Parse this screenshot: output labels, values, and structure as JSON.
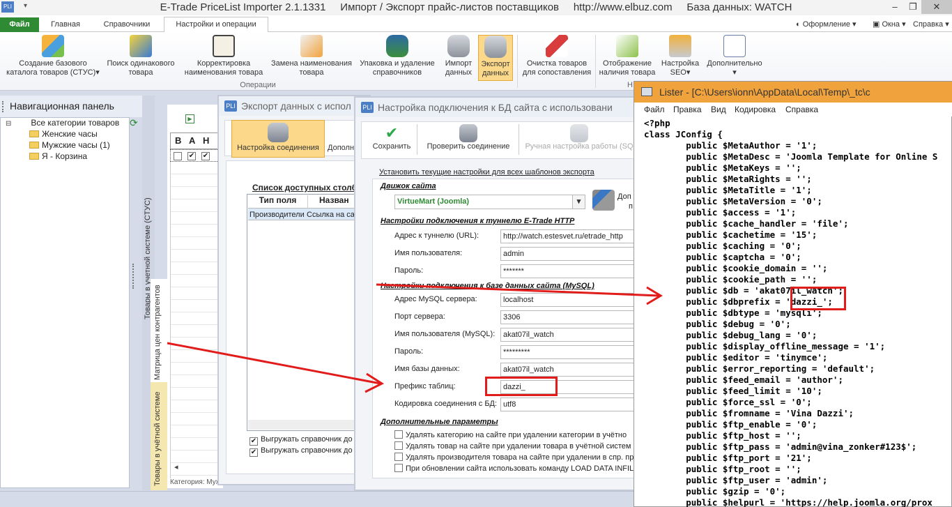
{
  "app": {
    "title": "E-Trade PriceList Importer 2.1.1331     Импорт / Экспорт прайс-листов поставщиков     http://www.elbuz.com     База данных: WATCH",
    "logo_text": "PLI"
  },
  "tabs": {
    "file": "Файл",
    "home": "Главная",
    "refs": "Справочники",
    "settings": "Настройки и операции"
  },
  "top_right": {
    "design": "Оформление",
    "windows": "Окна",
    "help": "Справка"
  },
  "ribbon": {
    "b1": "Создание базового\nкаталога товаров (СТУС)",
    "b2": "Поиск одинакового\nтовара",
    "b3": "Корректировка\nнаименования товара",
    "b4": "Замена наименования\nтовара",
    "b5": "Упаковка и удаление\nсправочников",
    "b6": "Импорт\nданных",
    "b7": "Экспорт\nданных",
    "b8": "Очистка товаров\nдля сопоставления",
    "b9": "Отображение\nналичия товара",
    "b10": "Настройка\nSEO",
    "b11": "Дополнительно",
    "group_ops": "Операции",
    "group_trunc": "Н"
  },
  "nav": {
    "title": "Навигационная панель",
    "root": "Все категории товаров",
    "items": [
      "Женские часы",
      "Мужские часы (1)",
      "Я - Корзина"
    ]
  },
  "side_tabs": {
    "stus": "Товары в учетной системе (СТУС)",
    "matrix": "Матрица цен контрагентов",
    "goods": "Товары в учётной системе"
  },
  "grid": {
    "headers": [
      "В",
      "А",
      "Н"
    ],
    "category_status": "Категория: Мужские часы"
  },
  "export_win": {
    "title": "Экспорт данных с испол",
    "tb_connect": "Настройка соединения",
    "tb_more": "Дополн",
    "list_title": "Список доступных столб",
    "col1": "Тип поля",
    "col2": "Назван",
    "row_c1": "Производители",
    "row_c2": "Ссылка на са",
    "chk1": "Выгружать справочник до",
    "chk2": "Выгружать справочник до"
  },
  "db_win": {
    "title": "Настройка подключения к БД сайта с использовани",
    "tb_save": "Сохранить",
    "tb_check": "Проверить соединение",
    "tb_manual": "Ручная настройка работы (SQ",
    "link_all": "Установить текущие настройки для всех шаблонов экспорта",
    "sec_engine": "Движок сайта",
    "engine": "VirtueMart (Joomla)",
    "extra_a": "Доп",
    "extra_b": "п",
    "sec_tunnel": "Настройки подключения к туннелю E-Trade HTTP",
    "l_tunnel": "Адрес к туннелю (URL):",
    "v_tunnel": "http://watch.estesvet.ru/etrade_http",
    "l_user": "Имя пользователя:",
    "v_user": "admin",
    "l_pass": "Пароль:",
    "v_pass": "*******",
    "sec_mysql": "Настройки подключения к базе данных сайта (MySQL)",
    "l_host": "Адрес MySQL сервера:",
    "v_host": "localhost",
    "l_port": "Порт сервера:",
    "v_port": "3306",
    "l_muser": "Имя пользователя (MySQL):",
    "v_muser": "akat07il_watch",
    "l_mpass": "Пароль:",
    "v_mpass": "*********",
    "l_dbname": "Имя базы данных:",
    "v_dbname": "akat07il_watch",
    "l_prefix": "Префикс таблиц:",
    "v_prefix": "dazzi_",
    "l_enc": "Кодировка соединения с БД:",
    "v_enc": "utf8",
    "sec_extra": "Дополнительные параметры",
    "opt1": "Удалять категорию на сайте при удалении категории в учётно",
    "opt2": "Удалять товар на сайте при удалении товара в учётной систем",
    "opt3": "Удалять производителя товара на сайте при удалении в спр. пр",
    "opt4": "При обновлении сайта использовать команду LOAD DATA INFILE"
  },
  "lister": {
    "title": "Lister - [C:\\Users\\ionn\\AppData\\Local\\Temp\\_tc\\c",
    "menu": [
      "Файл",
      "Правка",
      "Вид",
      "Кодировка",
      "Справка"
    ],
    "code": "<?php\nclass JConfig {\n        public $MetaAuthor = '1';\n        public $MetaDesc = 'Joomla Template for Online S\n        public $MetaKeys = '';\n        public $MetaRights = '';\n        public $MetaTitle = '1';\n        public $MetaVersion = '0';\n        public $access = '1';\n        public $cache_handler = 'file';\n        public $cachetime = '15';\n        public $caching = '0';\n        public $captcha = '0';\n        public $cookie_domain = '';\n        public $cookie_path = '';\n        public $db = 'akat07il_watch';\n        public $dbprefix = 'dazzi_';\n        public $dbtype = 'mysqli';\n        public $debug = '0';\n        public $debug_lang = '0';\n        public $display_offline_message = '1';\n        public $editor = 'tinymce';\n        public $error_reporting = 'default';\n        public $feed_email = 'author';\n        public $feed_limit = '10';\n        public $force_ssl = '0';\n        public $fromname = 'Vina Dazzi';\n        public $ftp_enable = '0';\n        public $ftp_host = '';\n        public $ftp_pass = 'admin@vina_zonker#123$';\n        public $ftp_port = '21';\n        public $ftp_root = '';\n        public $ftp_user = 'admin';\n        public $gzip = '0';\n        public $helpurl = 'https://help.joomla.org/prox"
  },
  "colors": {
    "file_tab": "#2f8a34",
    "lister_title": "#f0a23c",
    "highlight": "#e21b1b",
    "active_button": "#fcd98a"
  }
}
